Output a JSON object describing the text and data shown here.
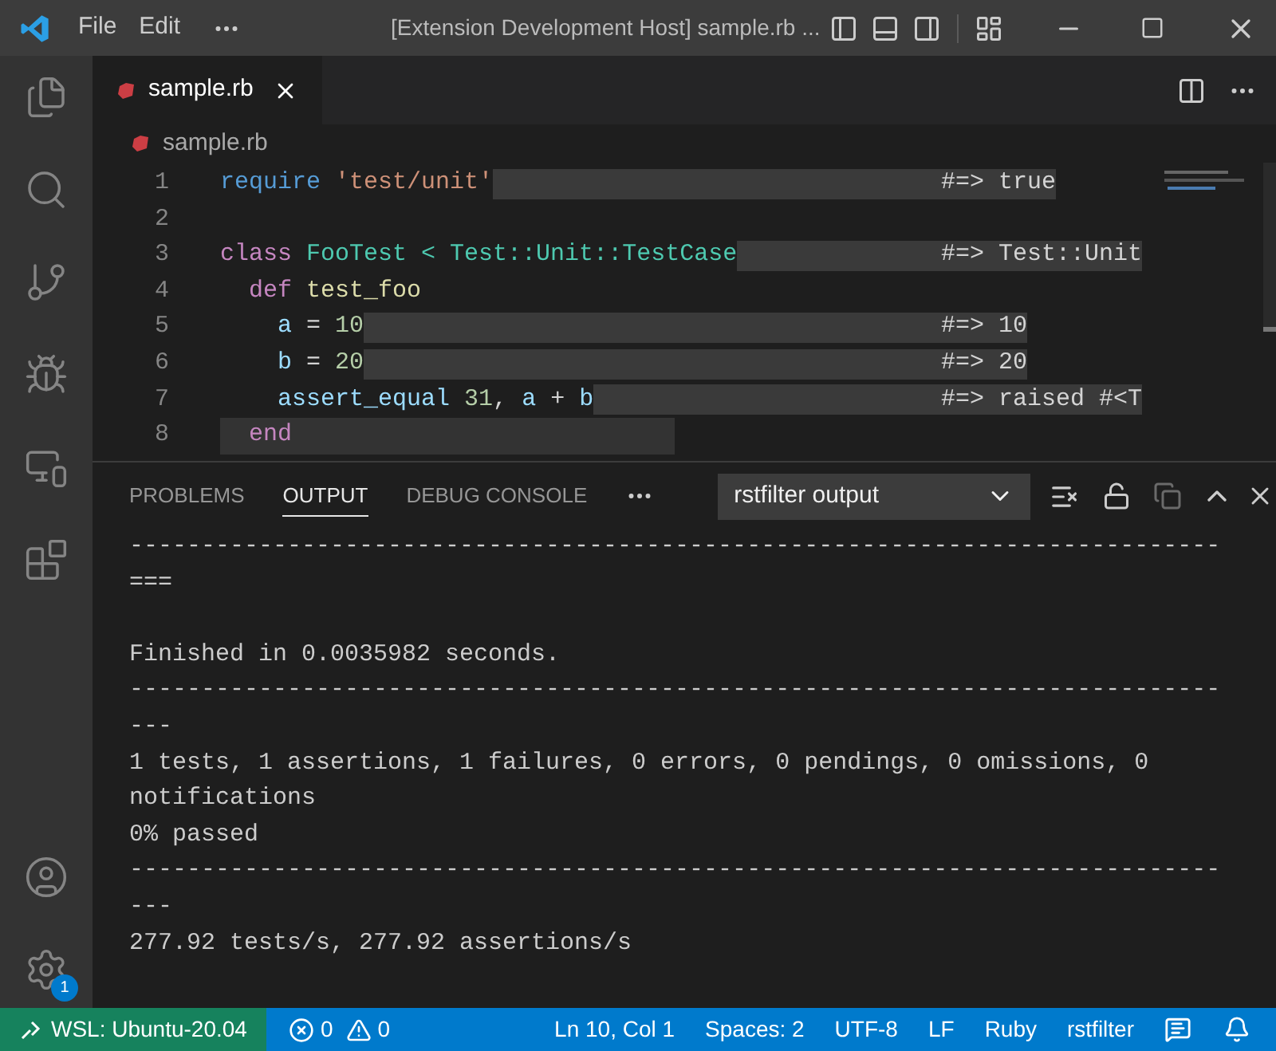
{
  "title_bar": {
    "menu": [
      "File",
      "Edit"
    ],
    "title": "[Extension Development Host] sample.rb ..."
  },
  "activity_bar": {
    "settings_badge": "1"
  },
  "tabs": [
    {
      "label": "sample.rb",
      "selected": true
    }
  ],
  "breadcrumb": "sample.rb",
  "editor": {
    "lines": [
      {
        "number": "1",
        "highlighted": false,
        "tokens": [
          {
            "text": "require",
            "kind": "keyword"
          },
          {
            "text": " 'test/unit'",
            "kind": "string"
          }
        ],
        "annotation": "#=> true"
      },
      {
        "number": "2",
        "highlighted": false
      },
      {
        "number": "3",
        "highlighted": false,
        "tokens": [
          {
            "text": "class",
            "kind": "control"
          },
          {
            "text": " FooTest",
            "kind": "type"
          },
          {
            "text": " < ",
            "kind": "type"
          },
          {
            "text": "Test::Unit::TestCase",
            "kind": "type"
          }
        ],
        "annotation": "#=> Test::Unit"
      },
      {
        "number": "4",
        "highlighted": false,
        "tokens": [
          {
            "text": "  def",
            "kind": "control"
          },
          {
            "text": " test_foo",
            "kind": "function"
          }
        ]
      },
      {
        "number": "5",
        "highlighted": false,
        "tokens": [
          {
            "text": "    a",
            "kind": "variable"
          },
          {
            "text": " = ",
            "kind": "plain"
          },
          {
            "text": "10",
            "kind": "number"
          }
        ],
        "annotation": "#=> 10"
      },
      {
        "number": "6",
        "highlighted": false,
        "tokens": [
          {
            "text": "    b",
            "kind": "variable"
          },
          {
            "text": " = ",
            "kind": "plain"
          },
          {
            "text": "20",
            "kind": "number"
          }
        ],
        "annotation": "#=> 20"
      },
      {
        "number": "7",
        "highlighted": false,
        "tokens": [
          {
            "text": "    assert_equal",
            "kind": "variable"
          },
          {
            "text": " 31",
            "kind": "number"
          },
          {
            "text": ", ",
            "kind": "plain"
          },
          {
            "text": "a",
            "kind": "variable"
          },
          {
            "text": " + ",
            "kind": "plain"
          },
          {
            "text": "b",
            "kind": "variable"
          }
        ],
        "annotation": "#=> raised #<T"
      },
      {
        "number": "8",
        "highlighted": true,
        "tokens": [
          {
            "text": "  end",
            "kind": "control"
          }
        ]
      }
    ]
  },
  "panel": {
    "tabs": [
      {
        "label": "PROBLEMS",
        "selected": false
      },
      {
        "label": "OUTPUT",
        "selected": true
      },
      {
        "label": "DEBUG CONSOLE",
        "selected": false
      }
    ],
    "channel": "rstfilter output",
    "output": [
      {
        "kind": "text",
        "text": "----------------------------------------------------------------------------"
      },
      {
        "kind": "text",
        "text": "==="
      },
      {
        "kind": "blank"
      },
      {
        "kind": "text",
        "text": "Finished in 0.0035982 seconds."
      },
      {
        "kind": "text",
        "text": "----------------------------------------------------------------------------"
      },
      {
        "kind": "text",
        "text": "---"
      },
      {
        "kind": "text",
        "text": "1 tests, 1 assertions, 1 failures, 0 errors, 0 pendings, 0 omissions, 0"
      },
      {
        "kind": "text",
        "text": "notifications"
      },
      {
        "kind": "text",
        "text": "0% passed"
      },
      {
        "kind": "text",
        "text": "----------------------------------------------------------------------------"
      },
      {
        "kind": "text",
        "text": "---"
      },
      {
        "kind": "text",
        "text": "277.92 tests/s, 277.92 assertions/s"
      }
    ]
  },
  "status_bar": {
    "remote": "WSL: Ubuntu-20.04",
    "errors": "0",
    "warnings": "0",
    "items": [
      "Ln 10, Col 1",
      "Spaces: 2",
      "UTF-8",
      "LF",
      "Ruby",
      "rstfilter"
    ]
  }
}
